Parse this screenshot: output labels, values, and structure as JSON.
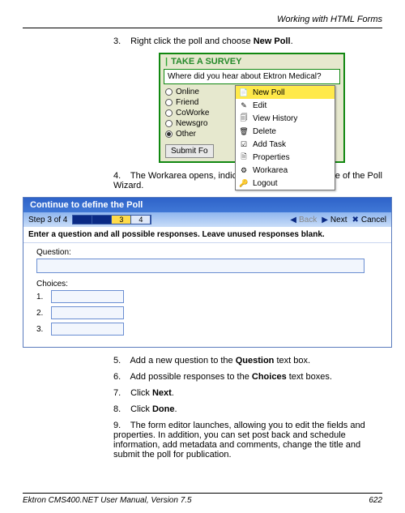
{
  "header": {
    "title": "Working with HTML Forms"
  },
  "steps": {
    "s3": {
      "num": "3.",
      "prefix": "Right click the poll and choose ",
      "bold": "New Poll",
      "suffix": "."
    },
    "s4": {
      "num": "4.",
      "text": "The Workarea opens, indicating you are at step three of the Poll Wizard."
    },
    "s5": {
      "num": "5.",
      "prefix": "Add a new question to the ",
      "bold": "Question",
      "suffix": " text box."
    },
    "s6": {
      "num": "6.",
      "prefix": "Add possible responses to the ",
      "bold": "Choices",
      "suffix": " text boxes."
    },
    "s7": {
      "num": "7.",
      "prefix": "Click ",
      "bold": "Next",
      "suffix": "."
    },
    "s8": {
      "num": "8.",
      "prefix": "Click ",
      "bold": "Done",
      "suffix": "."
    },
    "s9": {
      "num": "9.",
      "text": "The form editor launches, allowing you to edit the fields and properties. In addition, you can set post back and schedule information, add metadata and comments, change the title and submit the poll for publication."
    }
  },
  "survey": {
    "heading": "TAKE A SURVEY",
    "question": "Where did you hear about Ektron Medical?",
    "options": [
      "Online",
      "Friend",
      "CoWorke",
      "Newsgro",
      "Other"
    ],
    "selected": 4,
    "submit": "Submit Fo"
  },
  "context_menu": {
    "items": [
      {
        "label": "New Poll",
        "icon": "📄"
      },
      {
        "label": "Edit",
        "icon": "✎"
      },
      {
        "label": "View History",
        "icon": "🗐"
      },
      {
        "label": "Delete",
        "icon": "🗑"
      },
      {
        "label": "Add Task",
        "icon": "☑"
      },
      {
        "label": "Properties",
        "icon": "🗎"
      },
      {
        "label": "Workarea",
        "icon": "⚙"
      },
      {
        "label": "Logout",
        "icon": "🔑"
      }
    ],
    "selected": 0
  },
  "wizard": {
    "title": "Continue to define the Poll",
    "step_label": "Step 3 of 4",
    "prog_cur": "3",
    "prog_next": "4",
    "back": "Back",
    "next": "Next",
    "cancel": "Cancel",
    "prompt": "Enter a question and all possible responses. Leave unused responses blank.",
    "question_label": "Question:",
    "choices_label": "Choices:",
    "choice_nums": [
      "1.",
      "2.",
      "3."
    ]
  },
  "footer": {
    "left": "Ektron CMS400.NET User Manual, Version 7.5",
    "right": "622"
  }
}
